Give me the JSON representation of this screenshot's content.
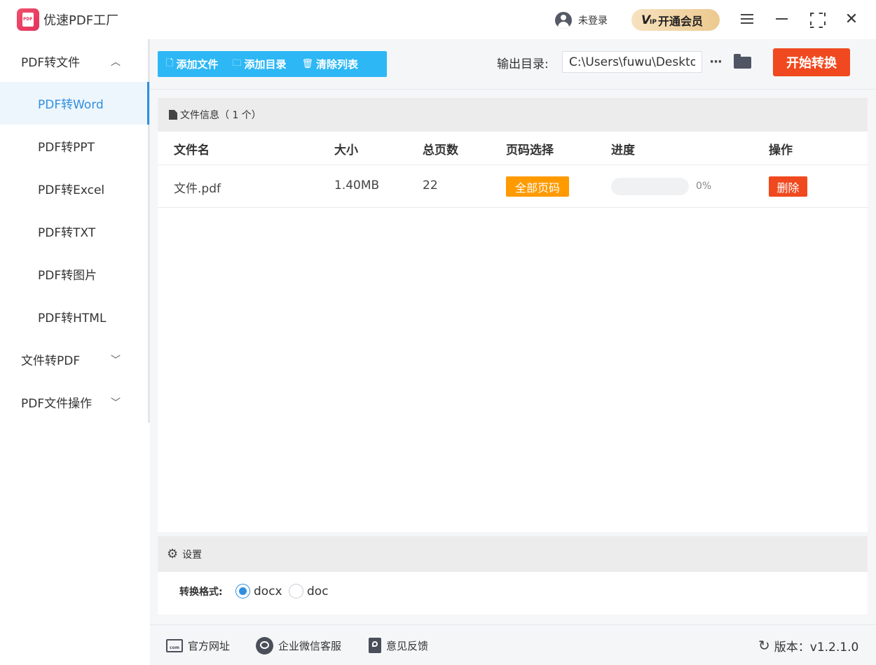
{
  "app": {
    "title": "优速PDF工厂",
    "logo_text": "PDF"
  },
  "header": {
    "login_label": "未登录",
    "vip_label": "开通会员",
    "vip_mark": "V",
    "vip_sub": "IP"
  },
  "sidebar": {
    "groups": [
      {
        "label": "PDF转文件",
        "expanded": true
      },
      {
        "label": "文件转PDF",
        "expanded": false
      },
      {
        "label": "PDF文件操作",
        "expanded": false
      }
    ],
    "items": [
      {
        "label": "PDF转Word",
        "active": true
      },
      {
        "label": "PDF转PPT"
      },
      {
        "label": "PDF转Excel"
      },
      {
        "label": "PDF转TXT"
      },
      {
        "label": "PDF转图片"
      },
      {
        "label": "PDF转HTML"
      }
    ]
  },
  "toolbar": {
    "add_file": "添加文件",
    "add_dir": "添加目录",
    "clear_list": "清除列表",
    "output_label": "输出目录:",
    "output_path": "C:\\Users\\fuwu\\Desktop",
    "more_label": "···",
    "start": "开始转换"
  },
  "files_panel": {
    "title": "文件信息（ 1 个）",
    "columns": [
      "文件名",
      "大小",
      "总页数",
      "页码选择",
      "进度",
      "操作"
    ],
    "rows": [
      {
        "name": "文件.pdf",
        "size": "1.40MB",
        "pages": "22",
        "page_select": "全部页码",
        "progress": 0,
        "progress_text": "0%",
        "action": "删除"
      }
    ]
  },
  "settings": {
    "title": "设置",
    "format_label": "转换格式:",
    "formats": [
      {
        "label": "docx",
        "checked": true
      },
      {
        "label": "doc",
        "checked": false
      }
    ]
  },
  "footer": {
    "website": "官方网址",
    "wechat": "企业微信客服",
    "feedback": "意见反馈",
    "version": "版本：v1.2.1.0",
    "web_icon_text": "com"
  },
  "colors": {
    "accent": "#2f8fe0",
    "toolbar": "#2db7f5",
    "danger": "#f0491f",
    "badge": "#ff9a00"
  }
}
